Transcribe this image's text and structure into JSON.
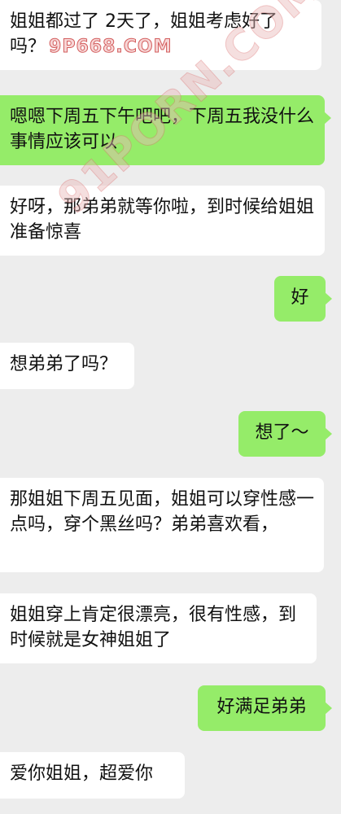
{
  "watermarks": {
    "inline": "9P668.COM",
    "diagonal": "91PORN.COM"
  },
  "messages": [
    {
      "side": "in",
      "text": "姐姐都过了 2天了，姐姐考虑好了吗？"
    },
    {
      "side": "out",
      "text": "嗯嗯下周五下午吧吧，下周五我没什么事情应该可以"
    },
    {
      "side": "in",
      "text": "好呀，那弟弟就等你啦，到时候给姐姐准备惊喜"
    },
    {
      "side": "out",
      "text": "好"
    },
    {
      "side": "in",
      "text": "想弟弟了吗？"
    },
    {
      "side": "out",
      "text": "想了～"
    },
    {
      "side": "in",
      "text": "那姐姐下周五见面，姐姐可以穿性感一点吗，穿个黑丝吗？弟弟喜欢看，"
    },
    {
      "side": "in",
      "text": "姐姐穿上肯定很漂亮，很有性感，到时候就是女神姐姐了"
    },
    {
      "side": "out",
      "text": "好满足弟弟"
    },
    {
      "side": "in",
      "text": "爱你姐姐，超爱你"
    }
  ],
  "colors": {
    "background": "#ededed",
    "incoming_bubble": "#ffffff",
    "outgoing_bubble": "#95ec69"
  }
}
